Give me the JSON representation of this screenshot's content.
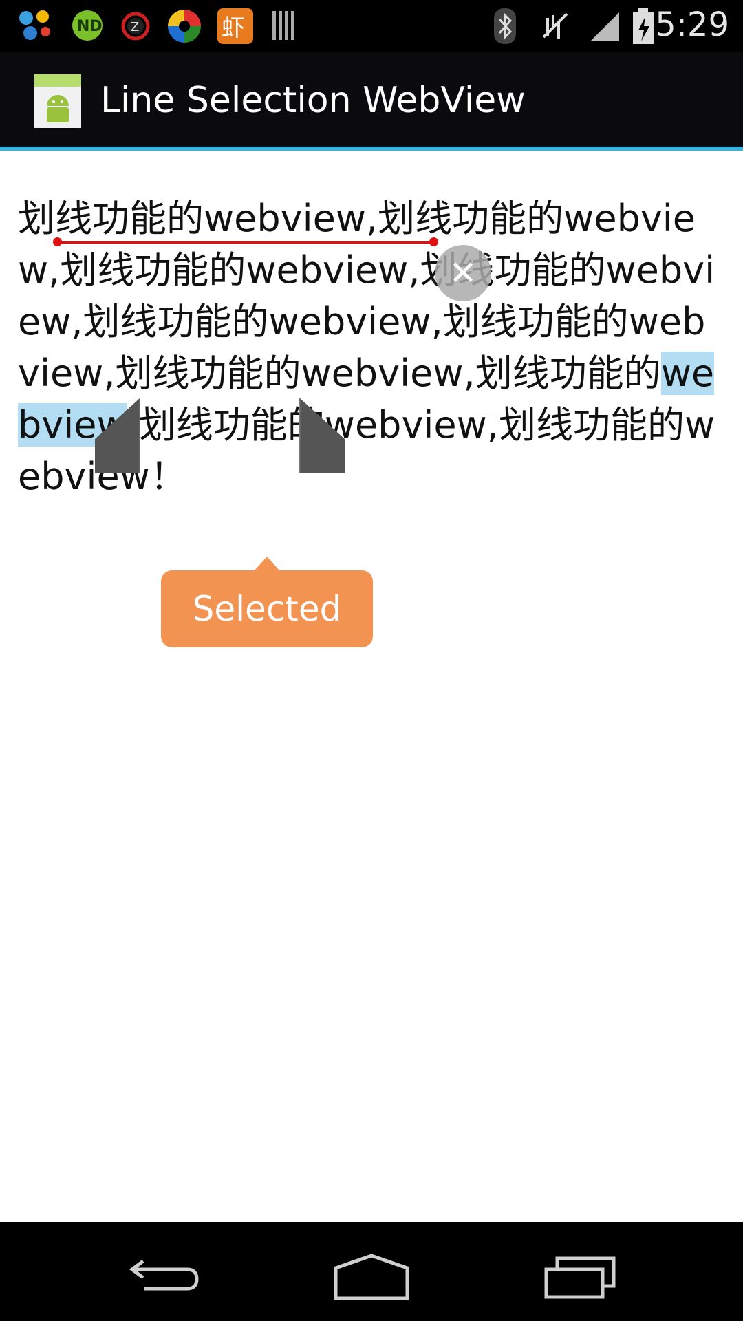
{
  "status_bar": {
    "time": "5:29",
    "notification_icons": [
      "colorful-app-icon",
      "nd-app-icon",
      "alarm-z-icon",
      "pinwheel-app-icon",
      "xia-music-app-icon",
      "barcode-icon"
    ],
    "system_icons": [
      "bluetooth-icon",
      "vibrate-off-icon",
      "signal-icon",
      "battery-charging-icon"
    ]
  },
  "action_bar": {
    "app_icon": "android-app-icon",
    "title": "Line Selection WebView",
    "accent_color": "#33b5e5"
  },
  "webview": {
    "text_before": "划线功能的webview,划线功能的webview,划线功能的webview,划线功能的webview,划线功能的webview,划线功能的webview,划线功能的webview,划线功能的",
    "selected_text": "webview",
    "text_after": ",划线功能的webview,划线功能的webview！",
    "underline_color": "#e01010",
    "selection_color": "#b2ddf3"
  },
  "popup": {
    "label": "Selected",
    "color": "#f39351"
  },
  "nav_bar": {
    "buttons": [
      "back-icon",
      "home-icon",
      "recents-icon"
    ]
  }
}
